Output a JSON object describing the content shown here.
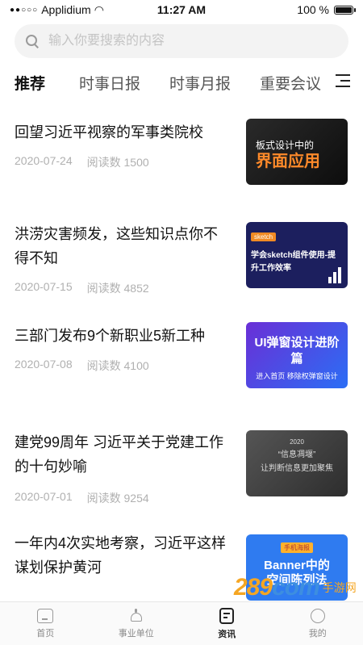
{
  "status_bar": {
    "carrier": "Applidium",
    "time": "11:27 AM",
    "battery": "100 %",
    "battery_level": 1.0
  },
  "search": {
    "placeholder": "输入你要搜索的内容"
  },
  "tabs": [
    "推荐",
    "时事日报",
    "时事月报",
    "重要会议"
  ],
  "articles": [
    {
      "title": "回望习近平视察的军事类院校",
      "date": "2020-07-24",
      "reads": "阅读数 1500",
      "thumb": {
        "line1": "板式设计中的",
        "line2": "界面应用"
      }
    },
    {
      "title": "洪涝灾害频发，这些知识点你不得不知",
      "date": "2020-07-15",
      "reads": "阅读数 4852",
      "thumb": {
        "tag": "sketch",
        "line1": "学会sketch组件使用-提升工作效率"
      }
    },
    {
      "title": "三部门发布9个新职业5新工种",
      "date": "2020-07-08",
      "reads": "阅读数 4100",
      "thumb": {
        "line1": "UI弹窗设计进阶篇",
        "line2": "进入首页 移除权弹窗设计"
      }
    },
    {
      "title": "建党99周年 习近平关于党建工作的十句妙喻",
      "date": "2020-07-01",
      "reads": "阅读数 9254",
      "thumb": {
        "year": "2020",
        "line1": "“信息凋堰”",
        "line2": "让判断信息更加聚焦"
      }
    },
    {
      "title": "一年内4次实地考察，习近平这样谋划保护黄河",
      "date": "",
      "reads": "",
      "thumb": {
        "tag": "手机海报",
        "line1": "Banner中的",
        "line2": "空间陈列法"
      }
    }
  ],
  "tabbar": [
    {
      "label": "首页",
      "icon": "home-icon"
    },
    {
      "label": "事业单位",
      "icon": "building-icon"
    },
    {
      "label": "资讯",
      "icon": "news-icon"
    },
    {
      "label": "我的",
      "icon": "profile-icon"
    }
  ],
  "watermark": {
    "logo_a": "289",
    "logo_b": "com",
    "site": "手游网"
  }
}
